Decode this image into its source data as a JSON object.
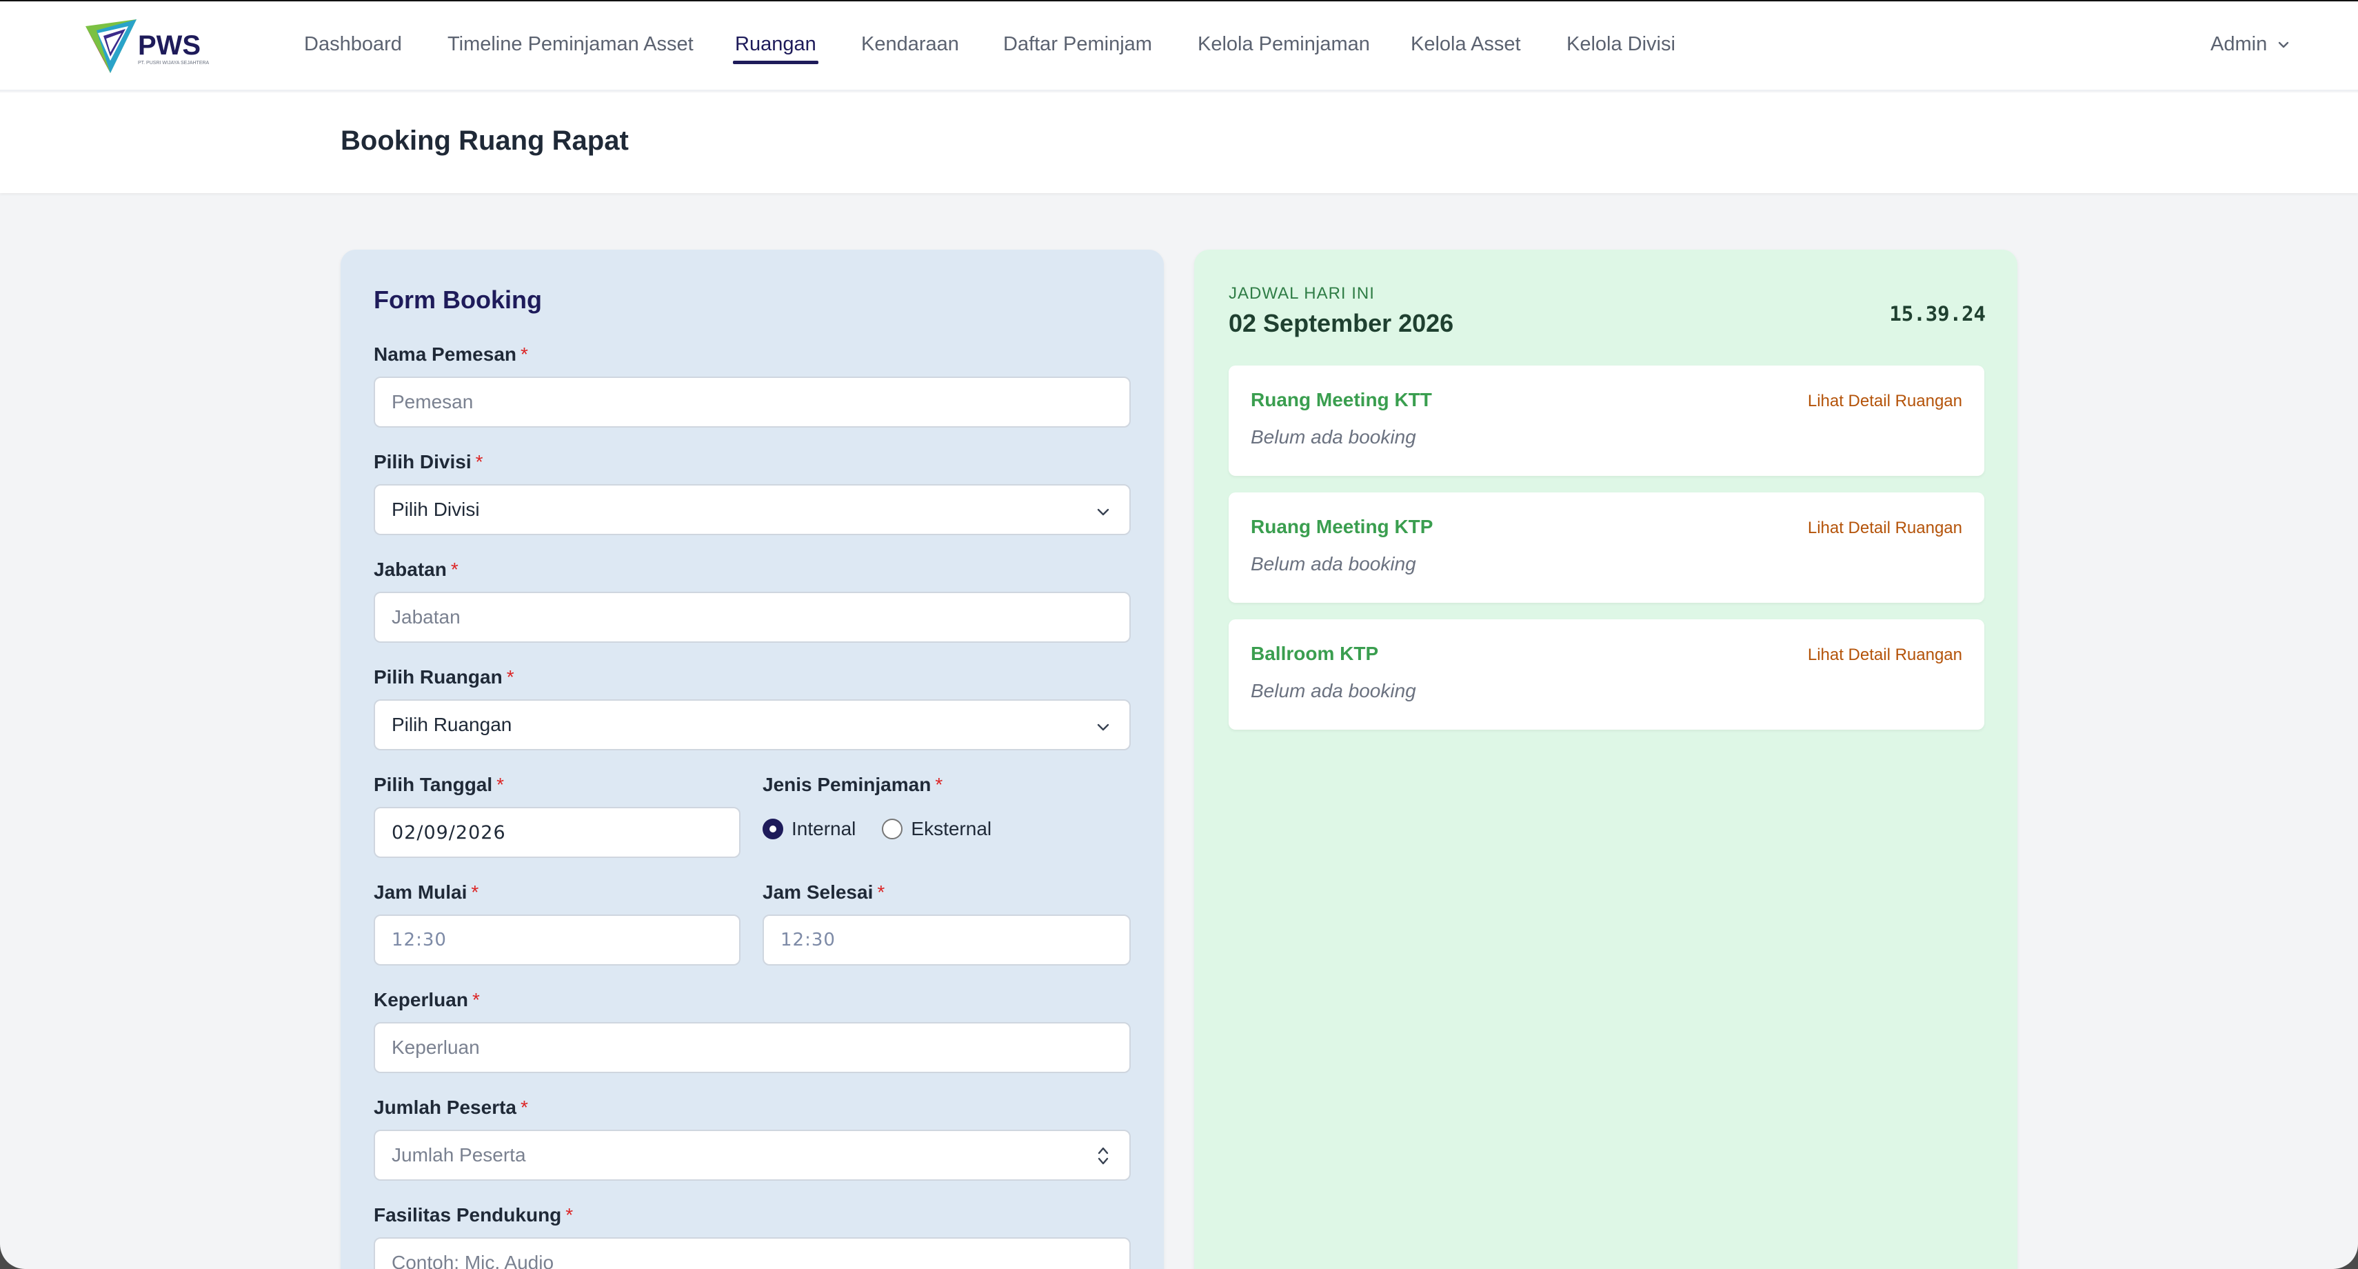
{
  "brand": {
    "name": "PWS",
    "tagline": "PT. PUSRI WIJAYA SEJAHTERA"
  },
  "nav": {
    "items": [
      {
        "label": "Dashboard"
      },
      {
        "label": "Timeline Peminjaman Asset"
      },
      {
        "label": "Ruangan"
      },
      {
        "label": "Kendaraan"
      },
      {
        "label": "Daftar Peminjam"
      },
      {
        "label": "Kelola Peminjaman"
      },
      {
        "label": "Kelola Asset"
      },
      {
        "label": "Kelola Divisi"
      }
    ],
    "active": "Ruangan",
    "user": "Admin"
  },
  "page": {
    "title": "Booking Ruang Rapat"
  },
  "form": {
    "title": "Form Booking",
    "required_mark": "*",
    "nama": {
      "label": "Nama Pemesan",
      "placeholder": "Pemesan"
    },
    "divisi": {
      "label": "Pilih Divisi",
      "value": "Pilih Divisi"
    },
    "jabatan": {
      "label": "Jabatan",
      "placeholder": "Jabatan"
    },
    "ruangan": {
      "label": "Pilih Ruangan",
      "value": "Pilih Ruangan"
    },
    "tanggal": {
      "label": "Pilih Tanggal",
      "value": "02/09/2026"
    },
    "jenis": {
      "label": "Jenis Peminjaman",
      "options": [
        "Internal",
        "Eksternal"
      ],
      "selected": "Internal"
    },
    "jam_mulai": {
      "label": "Jam Mulai",
      "value": "12:30"
    },
    "jam_selesai": {
      "label": "Jam Selesai",
      "value": "12:30"
    },
    "keperluan": {
      "label": "Keperluan",
      "placeholder": "Keperluan"
    },
    "jumlah": {
      "label": "Jumlah Peserta",
      "placeholder": "Jumlah Peserta"
    },
    "fasilitas": {
      "label": "Fasilitas Pendukung",
      "placeholder": "Contoh: Mic, Audio"
    }
  },
  "schedule": {
    "kicker": "JADWAL HARI INI",
    "date": "02 September 2026",
    "clock": "15.39.24",
    "rooms": [
      {
        "name": "Ruang Meeting KTT",
        "link": "Lihat Detail Ruangan",
        "status": "Belum ada booking"
      },
      {
        "name": "Ruang Meeting KTP",
        "link": "Lihat Detail Ruangan",
        "status": "Belum ada booking"
      },
      {
        "name": "Ballroom KTP",
        "link": "Lihat Detail Ruangan",
        "status": "Belum ada booking"
      }
    ]
  },
  "colors": {
    "brand_navy": "#1e1b5a",
    "form_bg": "#dde8f3",
    "schedule_bg": "#def7e6",
    "room_name": "#3a9e4f",
    "link": "#b45309",
    "required": "#dc2626"
  },
  "icons": [
    "pws-logo-icon",
    "chevron-down-icon",
    "number-spinner-icon",
    "radio-icon"
  ]
}
